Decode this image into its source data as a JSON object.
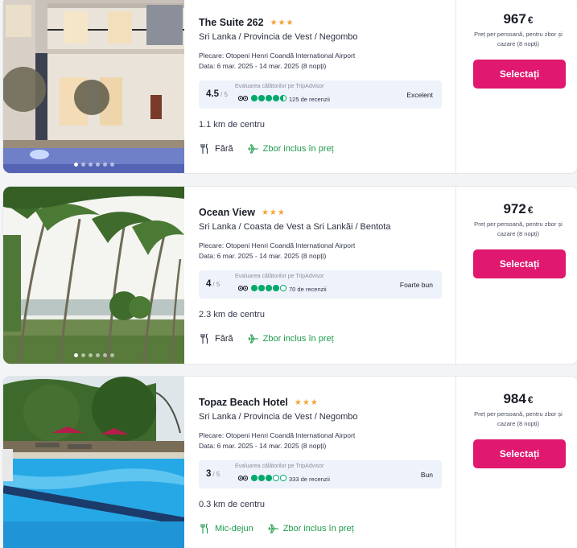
{
  "hotels": [
    {
      "name": "The Suite 262",
      "stars": "★★★",
      "location": "Sri Lanka / Provincia de Vest / Negombo",
      "departure": "Plecare: Otopeni Henri Coandă International Airport",
      "dates": "Data: 6 mar. 2025 - 14 mar. 2025 (8 nopți)",
      "rating_label": "Evaluarea călătorilor pe TripAdvisor",
      "score": "4.5",
      "score_out_of": "/ 5",
      "circles_filled": 4.5,
      "reviews": "125 de recenzii",
      "verdict": "Excelent",
      "distance": "1.1 km de centru",
      "meal": "Fără",
      "flight": "Zbor inclus în preț",
      "price": "967",
      "currency": "€",
      "price_note": "Preț per persoană, pentru zbor și cazare (8 nopți)",
      "select": "Selectați"
    },
    {
      "name": "Ocean View",
      "stars": "★★★",
      "location": "Sri Lanka / Coasta de Vest a Sri Lankăi / Bentota",
      "departure": "Plecare: Otopeni Henri Coandă International Airport",
      "dates": "Data: 6 mar. 2025 - 14 mar. 2025 (8 nopți)",
      "rating_label": "Evaluarea călătorilor pe TripAdvisor",
      "score": "4",
      "score_out_of": "/ 5",
      "circles_filled": 4,
      "reviews": "70 de recenzii",
      "verdict": "Foarte bun",
      "distance": "2.3 km de centru",
      "meal": "Fără",
      "flight": "Zbor inclus în preț",
      "price": "972",
      "currency": "€",
      "price_note": "Preț per persoană, pentru zbor și cazare (8 nopți)",
      "select": "Selectați"
    },
    {
      "name": "Topaz Beach Hotel",
      "stars": "★★★",
      "location": "Sri Lanka / Provincia de Vest / Negombo",
      "departure": "Plecare: Otopeni Henri Coandă International Airport",
      "dates": "Data: 6 mar. 2025 - 14 mar. 2025 (8 nopți)",
      "rating_label": "Evaluarea călătorilor pe TripAdvisor",
      "score": "3",
      "score_out_of": "/ 5",
      "circles_filled": 3,
      "reviews": "333 de recenzii",
      "verdict": "Bun",
      "distance": "0.3 km de centru",
      "meal": "Mic-dejun",
      "flight": "Zbor inclus în preț",
      "price": "984",
      "currency": "€",
      "price_note": "Preț per persoană, pentru zbor și cazare (8 nopți)",
      "select": "Selectați"
    }
  ],
  "colors": {
    "accent": "#e0186f",
    "stars": "#f2a33a",
    "tripadvisor": "#00aa6c",
    "flight": "#1e9a4b"
  },
  "icons": [
    "cutlery-icon",
    "plane-icon",
    "tripadvisor-owl-icon"
  ]
}
